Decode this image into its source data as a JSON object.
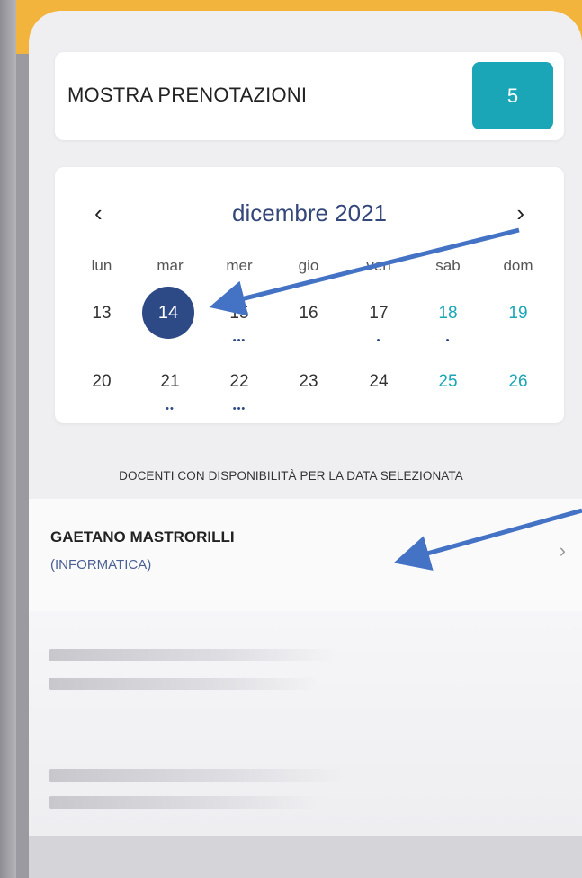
{
  "show_bookings": {
    "label": "MOSTRA PRENOTAZIONI",
    "count": "5"
  },
  "calendar": {
    "month": "dicembre 2021",
    "prev": "‹",
    "next": "›",
    "weekdays": [
      "lun",
      "mar",
      "mer",
      "gio",
      "ven",
      "sab",
      "dom"
    ],
    "week1": [
      "13",
      "14",
      "15",
      "16",
      "17",
      "18",
      "19"
    ],
    "week2": [
      "20",
      "21",
      "22",
      "23",
      "24",
      "25",
      "26"
    ],
    "selected_day": "14",
    "dots_week1": [
      "",
      "",
      "•••",
      "",
      "•",
      "•",
      ""
    ],
    "dots_week2": [
      "",
      "••",
      "•••",
      "",
      "",
      "",
      ""
    ],
    "colors": {
      "selected": "#2e4a86",
      "weekend": "#1aa6b7",
      "accent": "#1aa6b7"
    }
  },
  "section_heading": "DOCENTI CON DISPONIBILITÀ PER LA DATA SELEZIONATA",
  "teacher": {
    "name": "GAETANO MASTRORILLI",
    "subject": "(INFORMATICA)",
    "chevron_icon": "chevron-right-icon"
  },
  "annotations": {
    "arrow_color": "#4472c4"
  }
}
